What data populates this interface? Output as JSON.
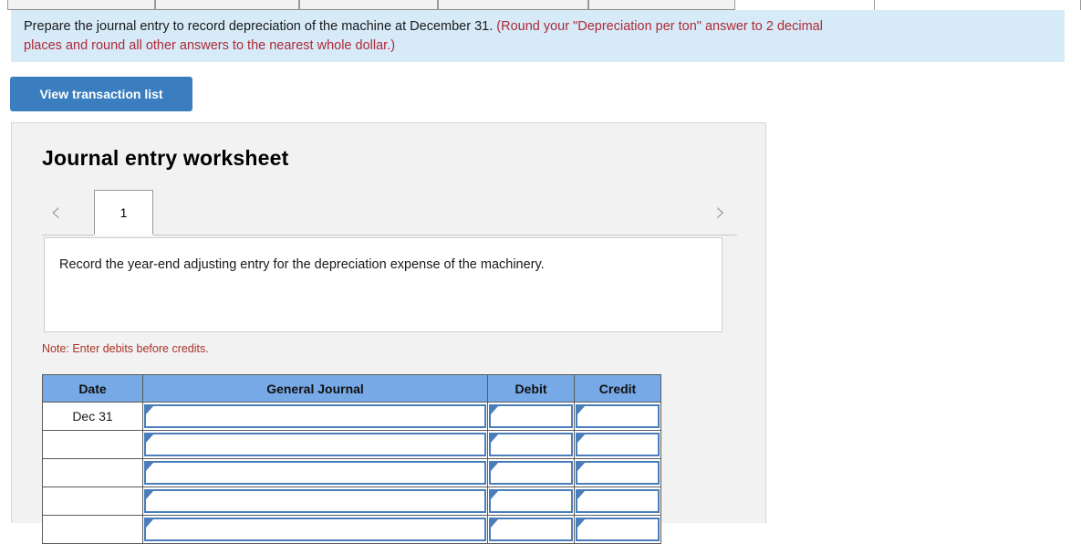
{
  "top_tabs": [
    {
      "name": "tab-stub-1"
    },
    {
      "name": "tab-stub-2"
    },
    {
      "name": "tab-stub-3"
    },
    {
      "name": "tab-stub-4"
    },
    {
      "name": "tab-stub-5"
    },
    {
      "name": "tab-stub-6"
    }
  ],
  "instruction": {
    "main_text": "Prepare the journal entry to record depreciation of the machine at December 31. ",
    "hint_text_part1": "(Round your \"Depreciation per ton\" answer to 2 decimal",
    "hint_text_part2": "places and round all other answers to the nearest whole dollar.)",
    "background_color": "#d6eaf8",
    "hint_color": "#b02a37"
  },
  "toolbar": {
    "view_transaction_list_label": "View transaction list",
    "button_color": "#3a7ebf"
  },
  "worksheet": {
    "title": "Journal entry worksheet",
    "pager": {
      "prev_icon": "chevron-left-icon",
      "next_icon": "chevron-right-icon",
      "prev_glyph": "‹",
      "next_glyph": "›",
      "pages": [
        "1"
      ],
      "active_page": "1"
    },
    "description": "Record the year-end adjusting entry for the depreciation expense of the machinery.",
    "note": "Note: Enter debits before credits.",
    "note_color": "#a93226"
  },
  "journal_table": {
    "header_color": "#76a9e5",
    "columns": [
      "Date",
      "General Journal",
      "Debit",
      "Credit"
    ],
    "rows": [
      {
        "date": "Dec 31",
        "general_journal": "",
        "debit": "",
        "credit": ""
      },
      {
        "date": "",
        "general_journal": "",
        "debit": "",
        "credit": ""
      },
      {
        "date": "",
        "general_journal": "",
        "debit": "",
        "credit": ""
      },
      {
        "date": "",
        "general_journal": "",
        "debit": "",
        "credit": ""
      },
      {
        "date": "",
        "general_journal": "",
        "debit": "",
        "credit": ""
      }
    ]
  }
}
